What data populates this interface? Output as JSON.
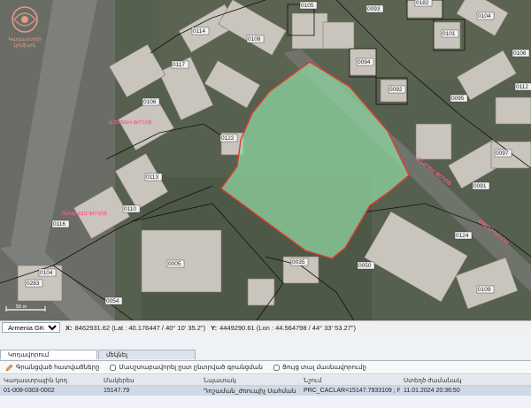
{
  "logo": {
    "title_line1": "Կադաստրի",
    "title_line2": "կոմիտե"
  },
  "map": {
    "parcel_labels": [
      "0105",
      "0182",
      "0104",
      "0114",
      "0108",
      "0101",
      "0094",
      "0092",
      "0117",
      "0106",
      "0122",
      "0095",
      "0113",
      "0091",
      "0110",
      "0124",
      "0109",
      "0283",
      "0104",
      "0035",
      "0005",
      "0106",
      "0050",
      "0116",
      "0093",
      "0112",
      "0054",
      "0097"
    ],
    "street_labels": [
      "Ա.ՇՈՏԱՎ ՓՈՂՈՑ",
      "ՈՍԿԵՎԱԶ ՓՈՂՈՑ",
      "Գ.ՆԺԴԵՀ ՓՈՂՈՑ",
      "ՀԱՍ ՆԻԿՈՂՈՍ"
    ],
    "scale": "50 m",
    "selection_color": "#8fd6a2"
  },
  "coordbar": {
    "projection": "Armenia GK-8",
    "x_label": "X:",
    "x_value": "8462931.62 (Lat : 40.176447 / 40° 10' 35.2\")",
    "y_label": "Y:",
    "y_value": "4449290.61 (Lon : 44.564798 / 44° 33' 53.27\")"
  },
  "tabs": [
    "Կոդավորում",
    "մեկնել"
  ],
  "toolbar": {
    "edit_label": "Գրանցված հատվածները",
    "check1_label": "Մասշտաբավորել ըստ ընտրված գրանցման",
    "check2_label": "Ցույց տալ մասնավորումը"
  },
  "table": {
    "headers": [
      "Կադաստրային կոդ",
      "Մակերես",
      "Նպատակ",
      "Նշում",
      "Ստեղծ ժամանակ"
    ],
    "rows": [
      [
        "01-008-0303-0002",
        "15147.79",
        "Դոշաման_ժռուպիչ Սահման",
        "PRC_CACLAR=15147.7933109 ; P...",
        "11.01.2024 20:36:50"
      ]
    ]
  }
}
